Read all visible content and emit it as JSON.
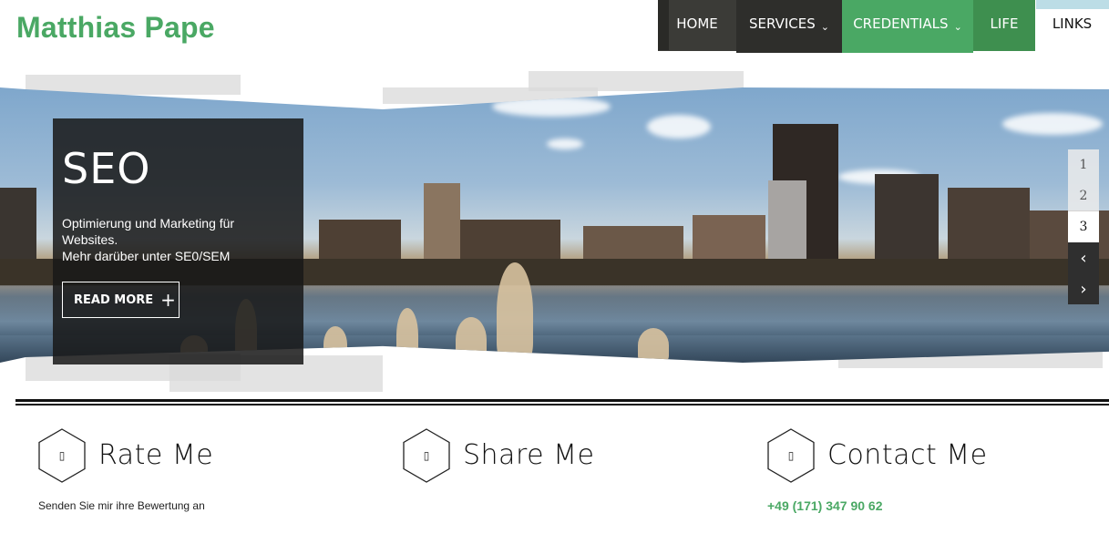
{
  "site": {
    "title": "Matthias Pape"
  },
  "nav": {
    "items": [
      {
        "label": "HOME"
      },
      {
        "label": "SERVICES",
        "dropdown": true
      },
      {
        "label": "CREDENTIALS",
        "dropdown": true
      },
      {
        "label": "LIFE"
      },
      {
        "label": "LINKS"
      }
    ],
    "colors": {
      "dark": "#3b3b37",
      "green": "#4aa864",
      "darkgreen": "#3e8f4f"
    }
  },
  "slider": {
    "caption": {
      "title": "SEO",
      "line1": "Optimierung und Marketing für Websites.",
      "line2": "Mehr darüber unter SE0/SEM",
      "button_label": "READ MORE",
      "button_icon": "plus-icon"
    },
    "pager": {
      "pages": [
        "1",
        "2",
        "3"
      ],
      "active": "3",
      "prev_icon": "chevron-left-icon",
      "next_icon": "chevron-right-icon",
      "prev_glyph": "‹",
      "next_glyph": "›"
    }
  },
  "features": [
    {
      "title": "Rate Me",
      "text": "Senden Sie mir ihre Bewertung an",
      "icon": "star-icon",
      "glyph": "▯"
    },
    {
      "title": "Share Me",
      "text": "",
      "icon": "share-icon",
      "glyph": "▯"
    },
    {
      "title": "Contact Me",
      "text": "+49 (171) 347 90 62",
      "icon": "phone-icon",
      "glyph": "▯"
    }
  ],
  "accent": "#4aa864"
}
